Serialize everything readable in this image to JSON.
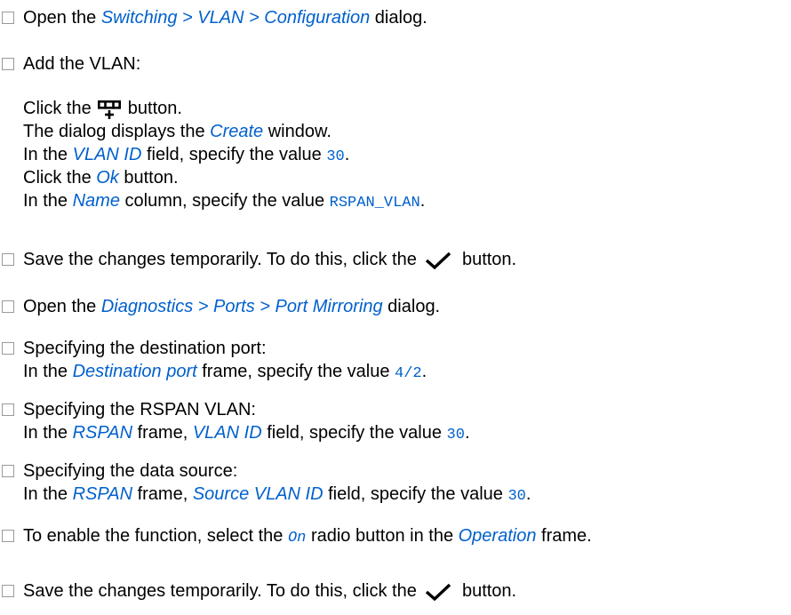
{
  "steps": {
    "s1": {
      "a": "Open the ",
      "b": "Switching > VLAN > Configuration",
      "c": " dialog."
    },
    "s2": {
      "title": "Add the VLAN:",
      "l1a": "Click the ",
      "l1b": " button.",
      "l2a": "The dialog displays the ",
      "l2b": "Create",
      "l2c": " window.",
      "l3a": "In the ",
      "l3b": "VLAN ID",
      "l3c": " field, specify the value ",
      "l3d": "30",
      "l3e": ".",
      "l4a": "Click the ",
      "l4b": "Ok",
      "l4c": " button.",
      "l5a": "In the ",
      "l5b": "Name",
      "l5c": " column, specify the value ",
      "l5d": "RSPAN_VLAN",
      "l5e": "."
    },
    "s3": {
      "a": "Save the changes temporarily. To do this, click the ",
      "b": " button."
    },
    "s4": {
      "a": "Open the ",
      "b": "Diagnostics > Ports > Port Mirroring",
      "c": " dialog."
    },
    "s5": {
      "title": "Specifying the destination port:",
      "a": "In the ",
      "b": "Destination port",
      "c": " frame, specify the value ",
      "d": "4/2",
      "e": "."
    },
    "s6": {
      "title": "Specifying the RSPAN VLAN:",
      "a": "In the ",
      "b": "RSPAN",
      "c": " frame, ",
      "d": "VLAN ID",
      "e": " field, specify the value ",
      "f": "30",
      "g": "."
    },
    "s7": {
      "title": "Specifying the data source:",
      "a": "In the ",
      "b": "RSPAN",
      "c": " frame, ",
      "d": "Source VLAN ID",
      "e": " field, specify the value ",
      "f": "30",
      "g": "."
    },
    "s8": {
      "a": "To enable the function, select the ",
      "b": "On",
      "c": " radio button in the ",
      "d": "Operation",
      "e": " frame."
    },
    "s9": {
      "a": "Save the changes temporarily. To do this, click the ",
      "b": " button."
    }
  },
  "icons": {
    "add": "add-row-icon",
    "save": "checkmark-icon"
  }
}
